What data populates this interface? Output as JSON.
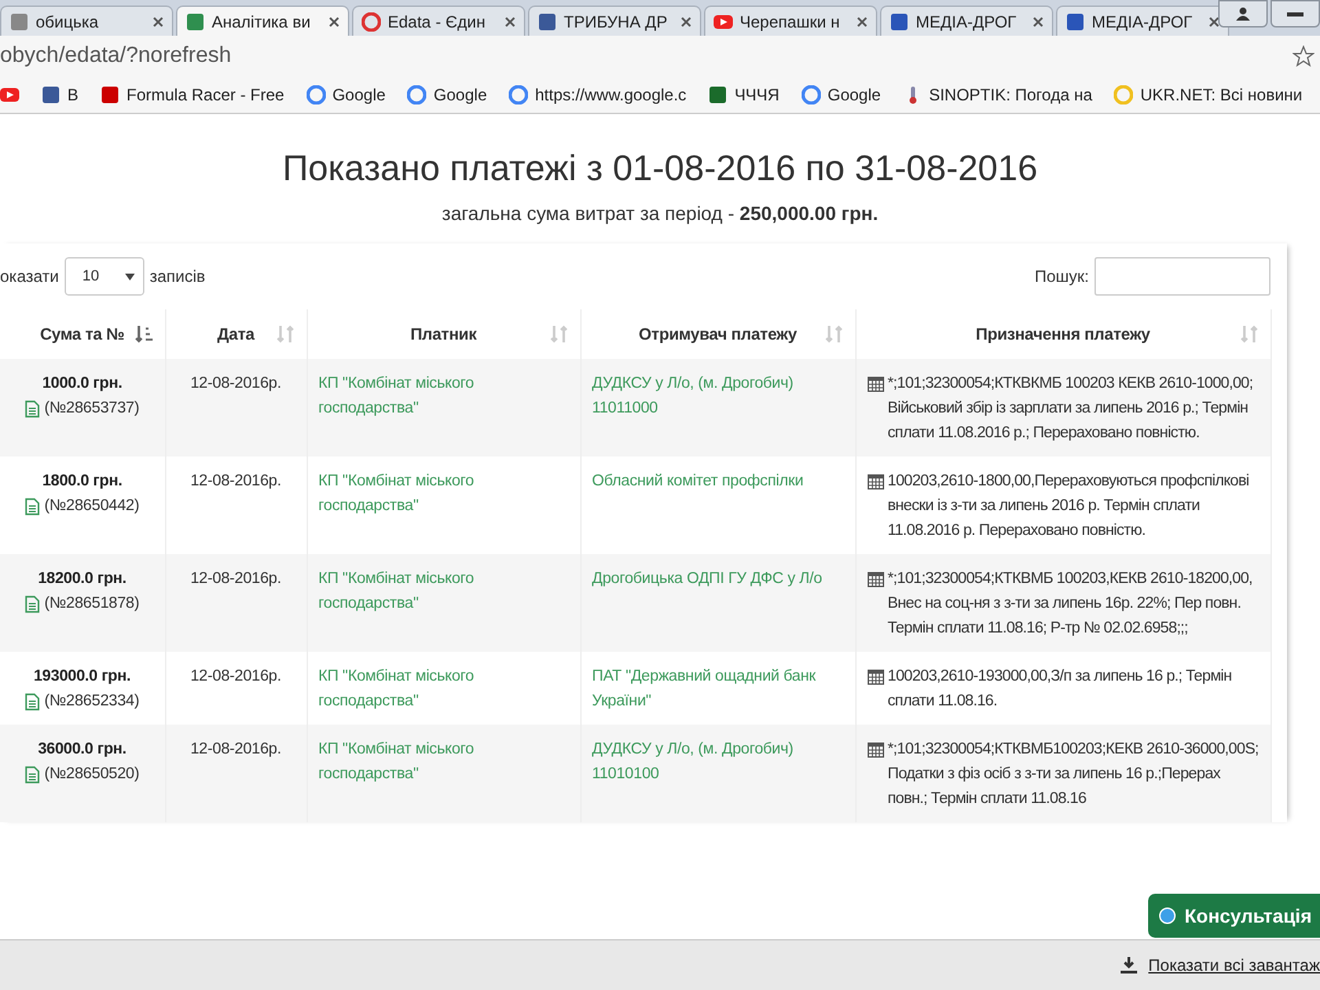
{
  "browser": {
    "tabs": [
      {
        "title": "обицька",
        "kind": "generic",
        "selected": false
      },
      {
        "title": "Аналітика ви",
        "kind": "chart",
        "selected": true
      },
      {
        "title": "Edata - Єдин",
        "kind": "edata",
        "selected": false
      },
      {
        "title": "ТРИБУНА ДР",
        "kind": "facebook",
        "selected": false
      },
      {
        "title": "Черепашки н",
        "kind": "youtube",
        "selected": false
      },
      {
        "title": "МЕДІА-ДРОГ",
        "kind": "media",
        "selected": false
      },
      {
        "title": "МЕДІА-ДРОГ",
        "kind": "media",
        "selected": false
      }
    ],
    "address": "obych/edata/?norefresh",
    "bookmarks": [
      {
        "kind": "youtube"
      },
      {
        "kind": "facebook",
        "label": "B"
      },
      {
        "kind": "racer",
        "label": "Formula Racer - Free"
      },
      {
        "kind": "google",
        "label": "Google"
      },
      {
        "kind": "google",
        "label": "Google"
      },
      {
        "kind": "google",
        "label": "https://www.google.c"
      },
      {
        "kind": "chchchya",
        "label": "ЧЧЧЯ"
      },
      {
        "kind": "google",
        "label": "Google"
      },
      {
        "kind": "thermo",
        "label": "SINOPTIK: Погода на"
      },
      {
        "kind": "ukrnet",
        "label": "UKR.NET: Всі новини"
      }
    ]
  },
  "heading": "Показано платежі з 01-08-2016 по 31-08-2016",
  "summary": "загальна сума витрат за період - **250,000.00 грн.**",
  "length_control": {
    "before": "оказати",
    "value": "10",
    "after": "записів"
  },
  "search": {
    "label": "Пошук:"
  },
  "table": {
    "columns": [
      {
        "label": "Сума та №",
        "sorted": true
      },
      {
        "label": "Дата",
        "sorted": false
      },
      {
        "label": "Платник",
        "sorted": false
      },
      {
        "label": "Отримувач платежу",
        "sorted": false
      },
      {
        "label": "Призначення платежу",
        "sorted": false
      }
    ],
    "rows": [
      {
        "amount": "1000.0 грн.",
        "number": "(№28653737)",
        "date": "12-08-2016р.",
        "payer": "КП \"Комбінат міського господарства\"",
        "recipient": "ДУДКСУ у Л/о, (м. Дрогобич) 11011000",
        "purpose": "*;101;32300054;КТКВКМБ 100203 КЕКВ 2610-1000,00; Військовий збір із зарплати за липень 2016 р.; Термін сплати 11.08.2016 р.; Перераховано повністю."
      },
      {
        "amount": "1800.0 грн.",
        "number": "(№28650442)",
        "date": "12-08-2016р.",
        "payer": "КП \"Комбінат міського господарства\"",
        "recipient": "Обласний комітет профспілки",
        "purpose": "100203,2610-1800,00,Перераховуються профспілкові внески із з-ти за липень 2016 р. Термін сплати 11.08.2016 р. Перераховано повністю."
      },
      {
        "amount": "18200.0 грн.",
        "number": "(№28651878)",
        "date": "12-08-2016р.",
        "payer": "КП \"Комбінат міського господарства\"",
        "recipient": "Дрогобицька ОДПІ ГУ ДФС у Л/о",
        "purpose": "*;101;32300054;КТКВМБ 100203,КЕКВ 2610-18200,00, Внес на соц-ня з з-ти за липень 16р. 22%; Пер повн. Термін сплати 11.08.16; Р-тр № 02.02.6958;;;"
      },
      {
        "amount": "193000.0 грн.",
        "number": "(№28652334)",
        "date": "12-08-2016р.",
        "payer": "КП \"Комбінат міського господарства\"",
        "recipient": "ПАТ \"Державний ощадний банк України\"",
        "purpose": "100203,2610-193000,00,З/п за липень 16 р.; Термін сплати 11.08.16."
      },
      {
        "amount": "36000.0 грн.",
        "number": "(№28650520)",
        "date": "12-08-2016р.",
        "payer": "КП \"Комбінат міського господарства\"",
        "recipient": "ДУДКСУ у Л/о, (м. Дрогобич) 11010100",
        "purpose": "*;101;32300054;КТКВМБ100203;КЕКВ 2610-36000,00S; Податки з фіз осіб з з-ти за липень 16 р.;Перерах повн.; Термін сплати 11.08.16"
      }
    ]
  },
  "consult_button": "Консультація",
  "downloads_link": "Показати всі завантаж"
}
